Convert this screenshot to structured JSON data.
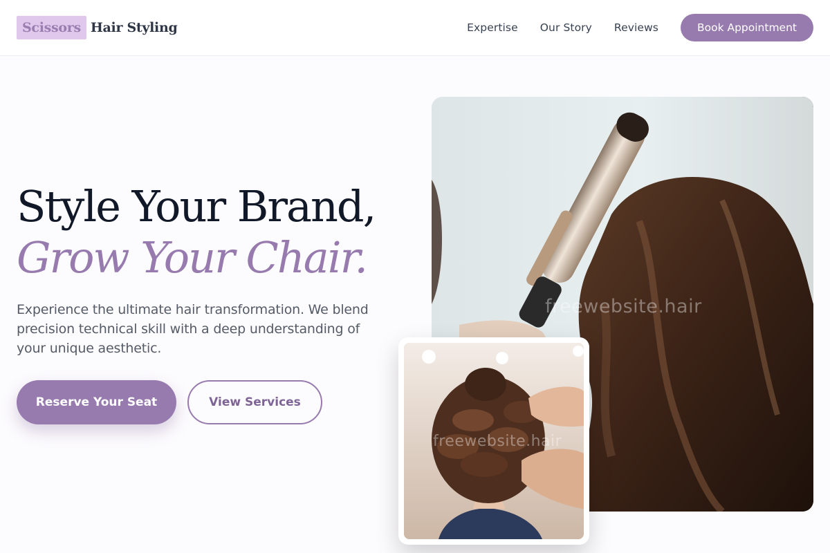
{
  "header": {
    "logo_mark": "Scissors",
    "logo_text": "Hair Styling",
    "nav": [
      {
        "label": "Expertise"
      },
      {
        "label": "Our Story"
      },
      {
        "label": "Reviews"
      }
    ],
    "cta_label": "Book Appointment"
  },
  "hero": {
    "title_line1": "Style Your Brand,",
    "title_line2": "Grow Your Chair.",
    "subtitle": "Experience the ultimate hair transformation. We blend precision technical skill with a deep understanding of your unique aesthetic.",
    "primary_button": "Reserve Your Seat",
    "secondary_button": "View Services"
  },
  "images": {
    "main_alt": "Stylist curling long brunette hair with a curling iron",
    "inset_alt": "Stylist pinning curls into an updo",
    "watermark_main": "freewebsite.hair",
    "watermark_inset": "freewebsite.hair"
  },
  "colors": {
    "accent": "#977aae",
    "logo_highlight": "#e0c8ec",
    "heading": "#111827",
    "body_text": "#555b66",
    "background": "#fcfbfd"
  }
}
